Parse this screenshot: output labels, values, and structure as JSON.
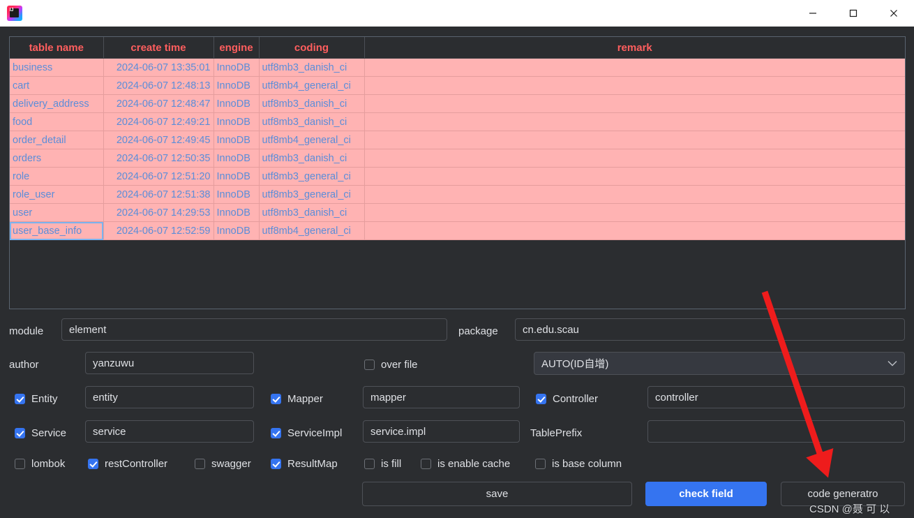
{
  "window": {
    "logo_text": "IJ",
    "controls": {
      "minimize": "minimize-icon",
      "maximize": "maximize-icon",
      "close": "close-icon"
    }
  },
  "table": {
    "columns": [
      "table name",
      "create time",
      "engine",
      "coding",
      "remark"
    ],
    "rows": [
      {
        "name": "business",
        "create_time": "2024-06-07 13:35:01",
        "engine": "InnoDB",
        "coding": "utf8mb3_danish_ci",
        "remark": "",
        "selected": false
      },
      {
        "name": "cart",
        "create_time": "2024-06-07 12:48:13",
        "engine": "InnoDB",
        "coding": "utf8mb4_general_ci",
        "remark": "",
        "selected": false
      },
      {
        "name": "delivery_address",
        "create_time": "2024-06-07 12:48:47",
        "engine": "InnoDB",
        "coding": "utf8mb3_danish_ci",
        "remark": "",
        "selected": false
      },
      {
        "name": "food",
        "create_time": "2024-06-07 12:49:21",
        "engine": "InnoDB",
        "coding": "utf8mb3_danish_ci",
        "remark": "",
        "selected": false
      },
      {
        "name": "order_detail",
        "create_time": "2024-06-07 12:49:45",
        "engine": "InnoDB",
        "coding": "utf8mb4_general_ci",
        "remark": "",
        "selected": false
      },
      {
        "name": "orders",
        "create_time": "2024-06-07 12:50:35",
        "engine": "InnoDB",
        "coding": "utf8mb3_danish_ci",
        "remark": "",
        "selected": false
      },
      {
        "name": "role",
        "create_time": "2024-06-07 12:51:20",
        "engine": "InnoDB",
        "coding": "utf8mb3_general_ci",
        "remark": "",
        "selected": false
      },
      {
        "name": "role_user",
        "create_time": "2024-06-07 12:51:38",
        "engine": "InnoDB",
        "coding": "utf8mb3_general_ci",
        "remark": "",
        "selected": false
      },
      {
        "name": "user",
        "create_time": "2024-06-07 14:29:53",
        "engine": "InnoDB",
        "coding": "utf8mb3_danish_ci",
        "remark": "",
        "selected": false
      },
      {
        "name": "user_base_info",
        "create_time": "2024-06-07 12:52:59",
        "engine": "InnoDB",
        "coding": "utf8mb4_general_ci",
        "remark": "",
        "selected": true
      }
    ]
  },
  "form": {
    "module_label": "module",
    "module_value": "element",
    "package_label": "package",
    "package_value": "cn.edu.scau",
    "author_label": "author",
    "author_value": "yanzuwu",
    "over_file_label": "over file",
    "over_file_checked": false,
    "id_strategy_value": "AUTO(ID自增)",
    "id_strategy_chevron": "chevron-down-icon",
    "entity_label": "Entity",
    "entity_checked": true,
    "entity_value": "entity",
    "mapper_label": "Mapper",
    "mapper_checked": true,
    "mapper_value": "mapper",
    "controller_label": "Controller",
    "controller_checked": true,
    "controller_value": "controller",
    "service_label": "Service",
    "service_checked": true,
    "service_value": "service",
    "serviceimpl_label": "ServiceImpl",
    "serviceimpl_checked": true,
    "serviceimpl_value": "service.impl",
    "tableprefix_label": "TablePrefix",
    "tableprefix_value": "",
    "lombok_label": "lombok",
    "lombok_checked": false,
    "restcontroller_label": "restController",
    "restcontroller_checked": true,
    "swagger_label": "swagger",
    "swagger_checked": false,
    "resultmap_label": "ResultMap",
    "resultmap_checked": true,
    "isfill_label": "is fill",
    "isfill_checked": false,
    "isenablecache_label": "is enable cache",
    "isenablecache_checked": false,
    "isbasecolumn_label": "is base column",
    "isbasecolumn_checked": false
  },
  "buttons": {
    "save": "save",
    "check_field": "check field",
    "code_generator": "code generatro"
  },
  "annotation": {
    "arrow": "red-arrow-annotation",
    "arrow_color": "#ee1c1c",
    "watermark": "CSDN @聂 可 以"
  },
  "colors": {
    "background": "#2b2d30",
    "row_pink": "#ffb3b3",
    "row_text_blue": "#5b8dd9",
    "header_red": "#ff5e5e",
    "accent_blue": "#3574f0"
  }
}
